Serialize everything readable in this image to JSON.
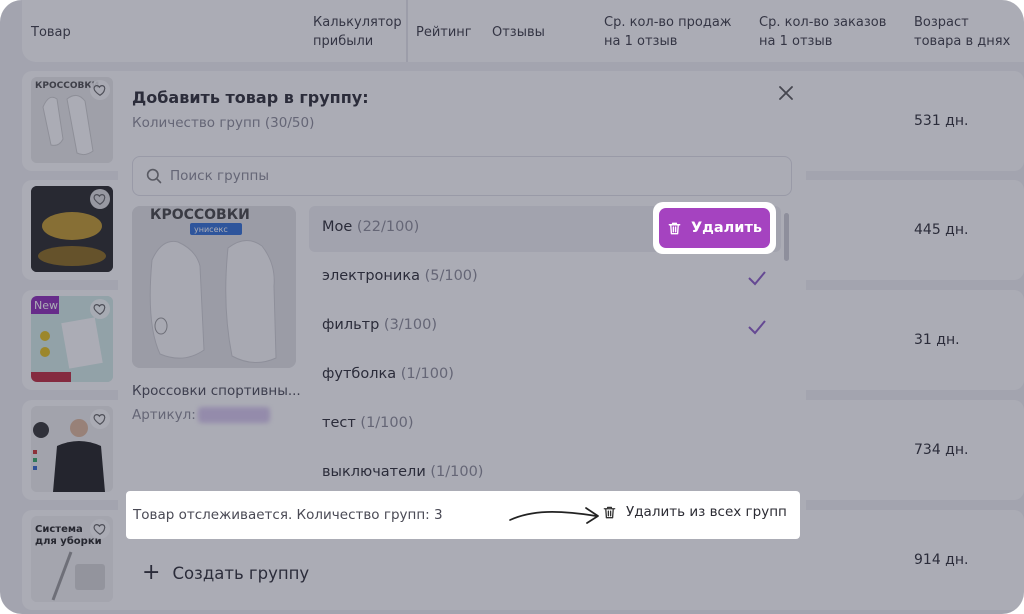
{
  "table": {
    "headers": {
      "product": "Товар",
      "calc_line1": "Калькулятор",
      "calc_line2": "прибыли",
      "rating": "Рейтинг",
      "reviews": "Отзывы",
      "sales_line1": "Ср. кол-во продаж",
      "sales_line2": "на 1 отзыв",
      "orders_line1": "Ср. кол-во заказов",
      "orders_line2": "на 1 отзыв",
      "age_line1": "Возраст",
      "age_line2": "товара в днях"
    },
    "rows": [
      {
        "age": "531 дн."
      },
      {
        "age": "445 дн."
      },
      {
        "age": "31 дн."
      },
      {
        "age": "734 дн."
      },
      {
        "age": "914 дн."
      }
    ],
    "thumb_texts": {
      "sneakers": "КРОССОВКИ",
      "new_badge": "New",
      "cleaning_line1": "Система",
      "cleaning_line2": "для уборки"
    }
  },
  "modal": {
    "title": "Добавить товар в группу:",
    "subtitle": "Количество групп (30/50)",
    "search_placeholder": "Поиск группы",
    "product": {
      "image_title": "КРОССОВКИ",
      "image_badge": "унисекс",
      "name": "Кроссовки спортивны...",
      "article_label": "Артикул:"
    },
    "groups": [
      {
        "name": "Мое",
        "count": "(22/100)",
        "checked": false,
        "active": true
      },
      {
        "name": "электроника",
        "count": "(5/100)",
        "checked": true,
        "active": false
      },
      {
        "name": "фильтр",
        "count": "(3/100)",
        "checked": true,
        "active": false
      },
      {
        "name": "футболка",
        "count": "(1/100)",
        "checked": false,
        "active": false
      },
      {
        "name": "тест",
        "count": "(1/100)",
        "checked": false,
        "active": false
      },
      {
        "name": "выключатели",
        "count": "(1/100)",
        "checked": false,
        "active": false
      }
    ],
    "delete_label": "Удалить",
    "tracking_text": "Товар отслеживается. Количество групп: 3",
    "delete_all_label": "Удалить из всех групп",
    "create_group_label": "Создать группу"
  },
  "colors": {
    "accent": "#a543c0",
    "check": "#8a5bc6",
    "overlay": "rgba(44,48,70,0.40)"
  },
  "icons": [
    "heart-icon",
    "close-icon",
    "search-icon",
    "trash-icon",
    "check-icon",
    "plus-icon",
    "arrow-icon"
  ]
}
